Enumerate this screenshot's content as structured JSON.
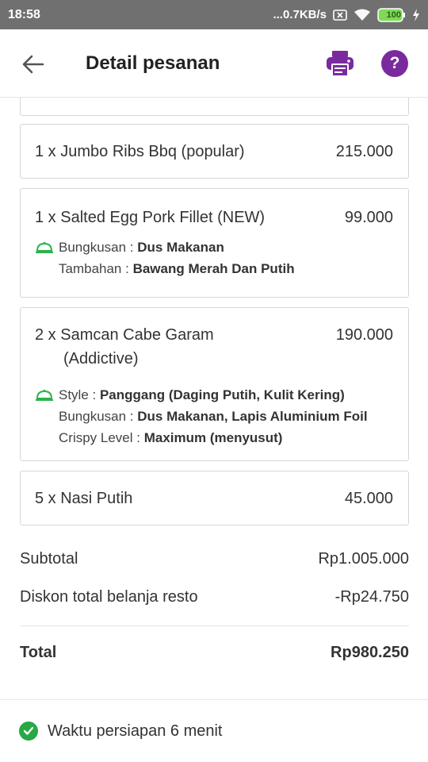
{
  "status_bar": {
    "time": "18:58",
    "network": "...0.7KB/s",
    "battery": "100"
  },
  "header": {
    "title": "Detail pesanan",
    "back_icon": "arrow-left-icon",
    "print_icon": "printer-icon",
    "help_icon": "help-icon",
    "help_label": "?"
  },
  "items": [
    {
      "name": "1 x Jumbo Ribs Bbq (popular)",
      "price": "215.000"
    },
    {
      "name": "1 x Salted Egg Pork Fillet (NEW)",
      "price": "99.000",
      "options": [
        {
          "label": "Bungkusan",
          "value": "Dus Makanan"
        },
        {
          "label": "Tambahan",
          "value": "Bawang Merah Dan Putih"
        }
      ]
    },
    {
      "name_line1": "2 x Samcan Cabe Garam",
      "name_line2": "(Addictive)",
      "price": "190.000",
      "options": [
        {
          "label": "Style",
          "value": "Panggang (Daging Putih, Kulit Kering)"
        },
        {
          "label": "Bungkusan",
          "value": "Dus Makanan, Lapis Aluminium Foil"
        },
        {
          "label": "Crispy Level",
          "value": "Maximum (menyusut)"
        }
      ]
    },
    {
      "name": "5 x Nasi Putih",
      "price": "45.000"
    }
  ],
  "summary": {
    "subtotal_label": "Subtotal",
    "subtotal_value": "Rp1.005.000",
    "discount_label": "Diskon total belanja resto",
    "discount_value": "-Rp24.750",
    "total_label": "Total",
    "total_value": "Rp980.250"
  },
  "footer": {
    "status_text": "Waktu persiapan 6 menit"
  },
  "colors": {
    "accent_purple": "#7b2a9e",
    "success_green": "#28a745",
    "status_bar": "#707070"
  }
}
